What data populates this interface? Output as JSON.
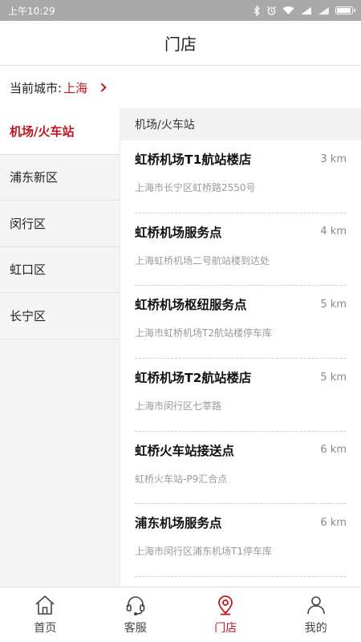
{
  "status": {
    "time": "上午10:29"
  },
  "header": {
    "title": "门店"
  },
  "city": {
    "label": "当前城市:",
    "value": "上海"
  },
  "districts": [
    "机场/火车站",
    "浦东新区",
    "闵行区",
    "虹口区",
    "长宁区"
  ],
  "active_district": "机场/火车站",
  "section": {
    "title": "机场/火车站"
  },
  "stores": [
    {
      "name": "虹桥机场T1航站楼店",
      "distance": "3 km",
      "address": "上海市长宁区虹桥路2550号"
    },
    {
      "name": "虹桥机场服务点",
      "distance": "4 km",
      "address": "上海虹桥机场二号航站楼到达处"
    },
    {
      "name": "虹桥机场枢纽服务点",
      "distance": "5 km",
      "address": "上海市虹桥机场T2航站楼停车库"
    },
    {
      "name": "虹桥机场T2航站楼店",
      "distance": "5 km",
      "address": "上海市闵行区七莘路"
    },
    {
      "name": "虹桥火车站接送点",
      "distance": "6 km",
      "address": "虹桥火车站-P9汇合点"
    },
    {
      "name": "浦东机场服务点",
      "distance": "6 km",
      "address": "上海市闵行区浦东机场T1停车库"
    }
  ],
  "tabs": [
    {
      "label": "首页",
      "icon": "home-icon"
    },
    {
      "label": "客服",
      "icon": "headset-icon"
    },
    {
      "label": "门店",
      "icon": "location-pin-icon"
    },
    {
      "label": "我的",
      "icon": "user-icon"
    }
  ],
  "active_tab": "门店",
  "colors": {
    "accent": "#c0161f",
    "status_bar": "#a9a9a9",
    "sidebar_bg": "#f5f5f5"
  }
}
